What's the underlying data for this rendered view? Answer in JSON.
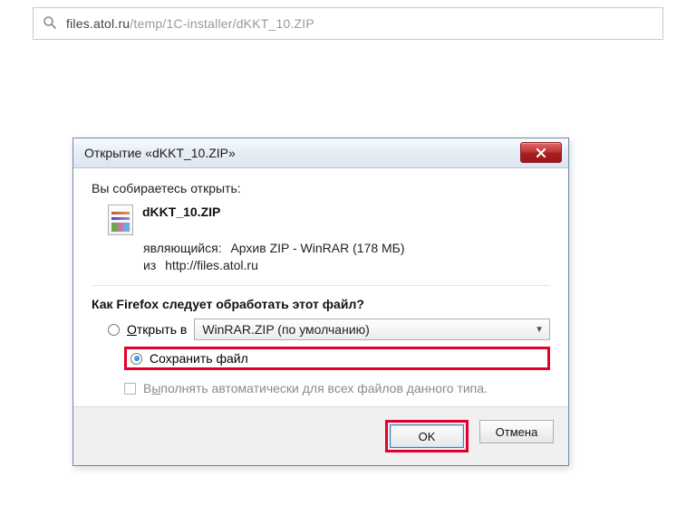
{
  "url": {
    "host": "files.atol.ru",
    "path": "/temp/1C-installer/dKKT_10.ZIP"
  },
  "dialog": {
    "title": "Открытие «dKKT_10.ZIP»",
    "intro": "Вы собираетесь открыть:",
    "file": {
      "name": "dKKT_10.ZIP",
      "type_label": "являющийся:",
      "type_value": "Архив ZIP - WinRAR (178 МБ)",
      "from_label": "из",
      "from_value": "http://files.atol.ru"
    },
    "question": "Как Firefox следует обработать этот файл?",
    "options": {
      "open_label_prefix": "О",
      "open_label_rest": "ткрыть в",
      "open_with_app": "WinRAR.ZIP (по умолчанию)",
      "save_label": "Сохранить файл"
    },
    "auto": {
      "prefix": "В",
      "underlined": "ы",
      "rest": "полнять автоматически для всех файлов данного типа."
    },
    "buttons": {
      "ok": "OK",
      "cancel": "Отмена"
    }
  }
}
